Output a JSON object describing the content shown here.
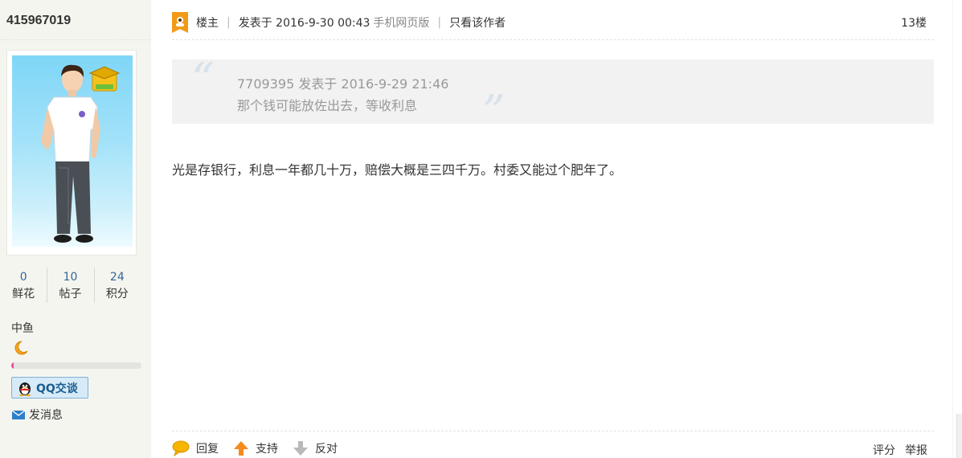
{
  "user": {
    "username": "415967019",
    "stats": [
      {
        "value": "0",
        "label": "鲜花"
      },
      {
        "value": "10",
        "label": "帖子"
      },
      {
        "value": "24",
        "label": "积分"
      }
    ],
    "level": "中鱼",
    "level_progress": 0.02,
    "qq_button": "QQ交谈",
    "message_link": "发消息"
  },
  "post": {
    "owner_label": "楼主",
    "posted_at": "发表于 2016-9-30 00:43",
    "mobile_version": "手机网页版",
    "only_author": "只看该作者",
    "floor": "13楼",
    "quote": {
      "meta": "7709395 发表于 2016-9-29 21:46",
      "text": "那个钱可能放佐出去，等收利息"
    },
    "body": "光是存银行，利息一年都几十万，赔偿大概是三四千万。村委又能过个肥年了。"
  },
  "footer": {
    "reply": "回复",
    "support": "支持",
    "oppose": "反对",
    "rate": "评分",
    "report": "举报"
  },
  "colors": {
    "level_bar": "#ee4a9b",
    "link_blue": "#336699",
    "quote_bg": "#f2f2f2"
  }
}
